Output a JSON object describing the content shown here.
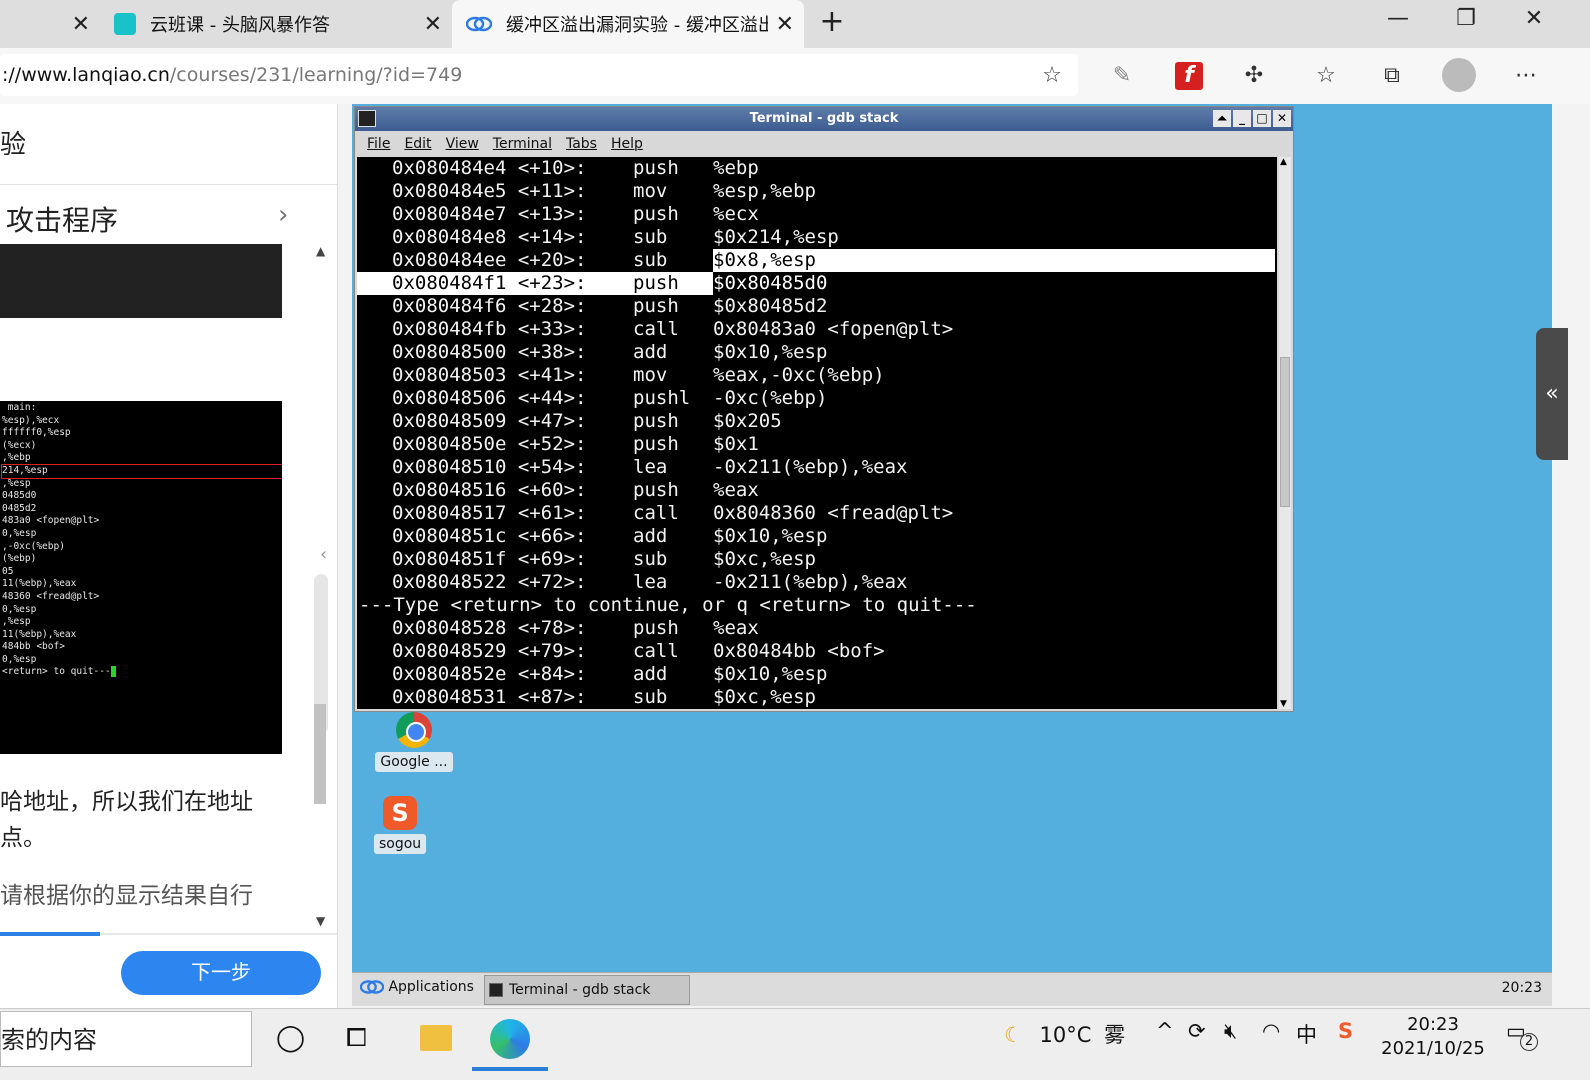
{
  "browser": {
    "tabs": [
      {
        "title": ""
      },
      {
        "title": "云班课 - 头脑风暴作答"
      },
      {
        "title": "缓冲区溢出漏洞实验 - 缓冲区溢出"
      }
    ],
    "url_host": "://www.lanqiao.cn",
    "url_path": "/courses/231/learning/?id=749"
  },
  "left_panel": {
    "header_partial": "验",
    "step_title": "攻击程序",
    "thumb_lines": [
      " main:",
      "%esp),%ecx",
      "ffffff0,%esp",
      "(%ecx)",
      "",
      ",%ebp",
      "",
      "214,%esp",
      ",%esp",
      "0485d0",
      "0485d2",
      "483a0 <fopen@plt>",
      "0,%esp",
      ",-0xc(%ebp)",
      "(%ebp)",
      "05",
      "",
      "11(%ebp),%eax",
      "",
      "48360 <fread@plt>",
      "0,%esp",
      ",%esp",
      "11(%ebp),%eax",
      "",
      "484bb <bof>",
      "0,%esp",
      "<return> to quit---"
    ],
    "para1_line1": "哈地址，所以我们在地址",
    "para1_line2": "点。",
    "para2_line1": "请根据你的显示结果自行",
    "next_button": "下一步"
  },
  "terminal": {
    "title": "Terminal - gdb stack",
    "menu": [
      "File",
      "Edit",
      "View",
      "Terminal",
      "Tabs",
      "Help"
    ],
    "rows": [
      {
        "addr": "0x080484e4 <+10>:",
        "op": "push",
        "arg": "%ebp"
      },
      {
        "addr": "0x080484e5 <+11>:",
        "op": "mov",
        "arg": "%esp,%ebp"
      },
      {
        "addr": "0x080484e7 <+13>:",
        "op": "push",
        "arg": "%ecx"
      },
      {
        "addr": "0x080484e8 <+14>:",
        "op": "sub",
        "arg": "$0x214,%esp"
      },
      {
        "addr": "0x080484ee <+20>:",
        "op": "sub",
        "arg": "$0x8,%esp"
      },
      {
        "addr": "0x080484f1 <+23>:",
        "op": "push",
        "arg": "$0x80485d0"
      },
      {
        "addr": "0x080484f6 <+28>:",
        "op": "push",
        "arg": "$0x80485d2"
      },
      {
        "addr": "0x080484fb <+33>:",
        "op": "call",
        "arg": "0x80483a0 <fopen@plt>"
      },
      {
        "addr": "0x08048500 <+38>:",
        "op": "add",
        "arg": "$0x10,%esp"
      },
      {
        "addr": "0x08048503 <+41>:",
        "op": "mov",
        "arg": "%eax,-0xc(%ebp)"
      },
      {
        "addr": "0x08048506 <+44>:",
        "op": "pushl",
        "arg": "-0xc(%ebp)"
      },
      {
        "addr": "0x08048509 <+47>:",
        "op": "push",
        "arg": "$0x205"
      },
      {
        "addr": "0x0804850e <+52>:",
        "op": "push",
        "arg": "$0x1"
      },
      {
        "addr": "0x08048510 <+54>:",
        "op": "lea",
        "arg": "-0x211(%ebp),%eax"
      },
      {
        "addr": "0x08048516 <+60>:",
        "op": "push",
        "arg": "%eax"
      },
      {
        "addr": "0x08048517 <+61>:",
        "op": "call",
        "arg": "0x8048360 <fread@plt>"
      },
      {
        "addr": "0x0804851c <+66>:",
        "op": "add",
        "arg": "$0x10,%esp"
      },
      {
        "addr": "0x0804851f <+69>:",
        "op": "sub",
        "arg": "$0xc,%esp"
      },
      {
        "addr": "0x08048522 <+72>:",
        "op": "lea",
        "arg": "-0x211(%ebp),%eax"
      },
      {
        "addr": "---Type <return> to continue, or q <return> to quit---",
        "op": "",
        "arg": ""
      },
      {
        "addr": "0x08048528 <+78>:",
        "op": "push",
        "arg": "%eax"
      },
      {
        "addr": "0x08048529 <+79>:",
        "op": "call",
        "arg": "0x80484bb <bof>"
      },
      {
        "addr": "0x0804852e <+84>:",
        "op": "add",
        "arg": "$0x10,%esp"
      },
      {
        "addr": "0x08048531 <+87>:",
        "op": "sub",
        "arg": "$0xc,%esp"
      }
    ],
    "highlight_arg_row": 4,
    "cursor_row": 5,
    "prompt_row": 19
  },
  "desktop": {
    "icons": [
      {
        "label": "Google ...",
        "icon": "chrome-icon"
      },
      {
        "label": "sogou",
        "icon": "sogou-icon"
      }
    ],
    "panel": {
      "applications": "Applications",
      "task": "Terminal - gdb stack",
      "clock": "20:23"
    }
  },
  "taskbar": {
    "search_text": "索的内容",
    "weather_temp": "10°C",
    "weather_desc": "雾",
    "ime": "中",
    "time": "20:23",
    "date": "2021/10/25",
    "notification_count": "2"
  }
}
